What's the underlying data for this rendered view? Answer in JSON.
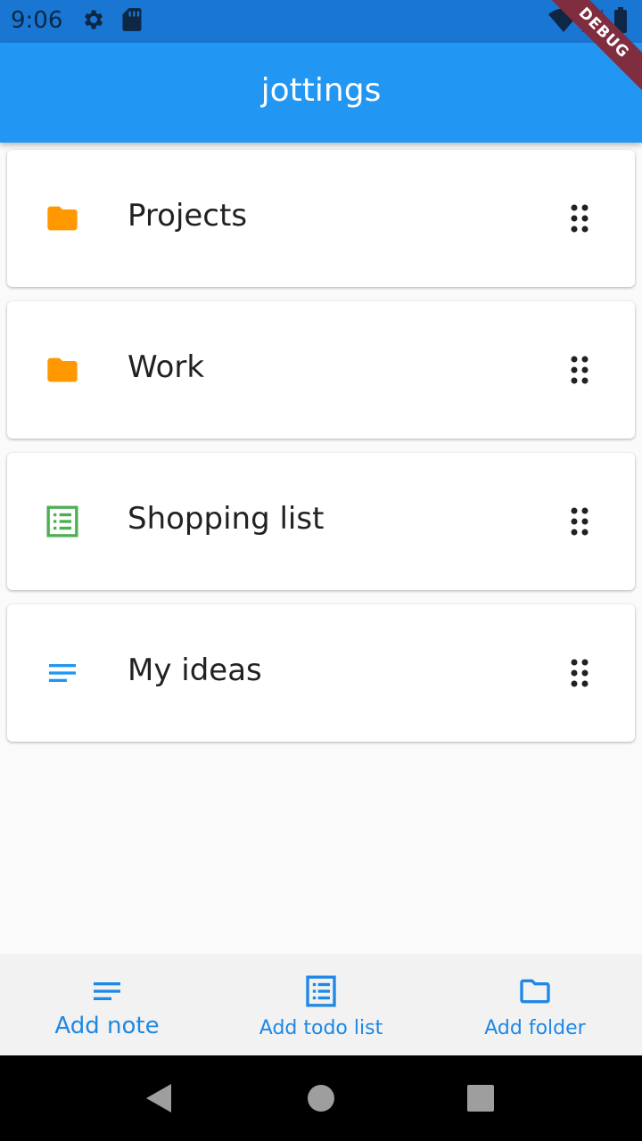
{
  "status_bar": {
    "time": "9:06",
    "icons": [
      "settings-icon",
      "sd-card-icon",
      "wifi-icon",
      "signal-icon",
      "battery-icon"
    ]
  },
  "debug_banner": "DEBUG",
  "app_bar": {
    "title": "jottings"
  },
  "items": [
    {
      "label": "Projects",
      "icon": "folder-icon",
      "color": "#ff9800"
    },
    {
      "label": "Work",
      "icon": "folder-icon",
      "color": "#ff9800"
    },
    {
      "label": "Shopping list",
      "icon": "checklist-icon",
      "color": "#4caf50"
    },
    {
      "label": "My ideas",
      "icon": "notes-icon",
      "color": "#2196f3"
    }
  ],
  "bottom_actions": [
    {
      "label": "Add note",
      "icon": "notes-icon"
    },
    {
      "label": "Add todo list",
      "icon": "checklist-icon"
    },
    {
      "label": "Add folder",
      "icon": "folder-outline-icon"
    }
  ],
  "nav_bar": {
    "buttons": [
      "back-icon",
      "home-icon",
      "recents-icon"
    ]
  },
  "colors": {
    "accent": "#2196f3",
    "status_bar": "#1976d2",
    "folder": "#ff9800",
    "todo": "#4caf50",
    "action_text": "#1e88e5"
  }
}
